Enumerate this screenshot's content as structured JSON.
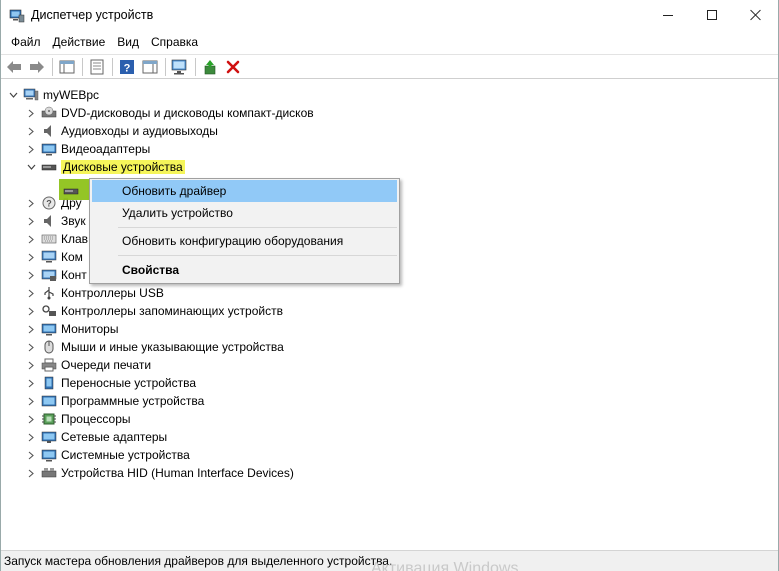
{
  "window": {
    "title": "Диспетчер устройств"
  },
  "menu": [
    "Файл",
    "Действие",
    "Вид",
    "Справка"
  ],
  "tree": {
    "root": "myWEBpc",
    "items": [
      {
        "label": "DVD-дисководы и дисководы компакт-дисков",
        "icon": "dvd-drive-icon"
      },
      {
        "label": "Аудиовходы и аудиовыходы",
        "icon": "speaker-icon"
      },
      {
        "label": "Видеоадаптеры",
        "icon": "display-adapter-icon"
      },
      {
        "label": "Дисковые устройства",
        "icon": "disk-drive-icon",
        "expanded": true
      },
      {
        "label": "Дру",
        "icon": "unknown-device-icon"
      },
      {
        "label": "Звук",
        "icon": "sound-icon"
      },
      {
        "label": "Клав",
        "icon": "keyboard-icon"
      },
      {
        "label": "Ком",
        "icon": "computer-icon"
      },
      {
        "label": "Конт",
        "icon": "controller-icon"
      },
      {
        "label": "Контроллеры USB",
        "icon": "usb-icon"
      },
      {
        "label": "Контроллеры запоминающих устройств",
        "icon": "storage-controller-icon"
      },
      {
        "label": "Мониторы",
        "icon": "monitor-icon"
      },
      {
        "label": "Мыши и иные указывающие устройства",
        "icon": "mouse-icon"
      },
      {
        "label": "Очереди печати",
        "icon": "printer-icon"
      },
      {
        "label": "Переносные устройства",
        "icon": "portable-device-icon"
      },
      {
        "label": "Программные устройства",
        "icon": "software-device-icon"
      },
      {
        "label": "Процессоры",
        "icon": "processor-icon"
      },
      {
        "label": "Сетевые адаптеры",
        "icon": "network-adapter-icon"
      },
      {
        "label": "Системные устройства",
        "icon": "system-device-icon"
      },
      {
        "label": "Устройства HID (Human Interface Devices)",
        "icon": "hid-icon"
      }
    ]
  },
  "context_menu": {
    "update_driver": "Обновить драйвер",
    "uninstall_device": "Удалить устройство",
    "scan_hardware": "Обновить конфигурацию оборудования",
    "properties": "Свойства"
  },
  "status": {
    "text": "Запуск мастера обновления драйверов для выделенного устройства.",
    "watermark": "Активация Windows"
  },
  "colors": {
    "yellow_highlight": "#f5f55a",
    "green_highlight": "#8ec21a",
    "menu_active": "#91c9f7",
    "remove_icon": "#d01010"
  }
}
